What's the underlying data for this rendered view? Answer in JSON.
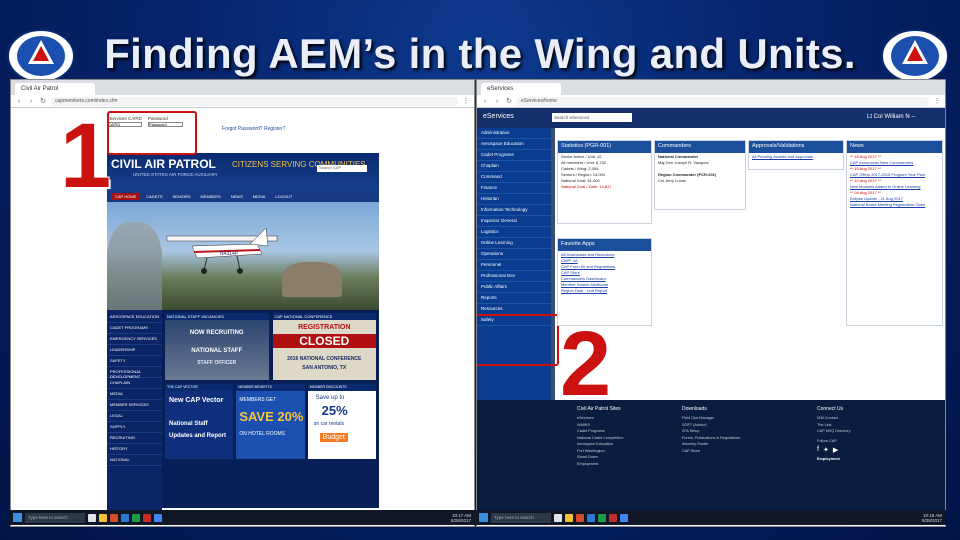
{
  "slide": {
    "title": "Finding AEM’s in the Wing and Units.",
    "step_one": "1",
    "step_two": "2",
    "colors": {
      "background": "#06236b",
      "highlight": "#cc1111",
      "title_text": "#e9eef8"
    }
  },
  "left_browser": {
    "tab_title": "Civil Air Patrol",
    "url": "capmembers.com/index.cfm",
    "login": {
      "user_label": "eServices CAPID",
      "pass_label": "Password",
      "user_value": "CAPID",
      "pass_value": "Password",
      "links": "Forgot Password?  Register?"
    },
    "site": {
      "logo": "CIVIL AIR PATROL",
      "logo_sub": "UNITED STATES AIR FORCE AUXILIARY",
      "tagline": "CITIZENS SERVING COMMUNITIES",
      "search_placeholder": "Search CAP",
      "nav": [
        "CAP HOME",
        "CADETS",
        "SENIORS",
        "MEMBERS",
        "NEWS",
        "MEDIA",
        "LOGOUT"
      ],
      "hero_plane_tail": "N4314P",
      "sidemenu": [
        "AEROSPACE EDUCATION",
        "CADET PROGRAMS",
        "EMERGENCY SERVICES",
        "LEADERSHIP",
        "SAFETY",
        "PROFESSIONAL DEVELOPMENT",
        "CHAPLAIN",
        "MEDIA",
        "MEMBER SERVICES",
        "LEGAL",
        "SUPPLY",
        "RECRUITING",
        "HISTORY",
        "NATIONAL"
      ],
      "panels": {
        "staff_vacancies": {
          "title": "NATIONAL STAFF VACANCIES",
          "line1": "NOW RECRUITING",
          "line2": "NATIONAL STAFF",
          "line3": "STAFF OFFICER"
        },
        "conference": {
          "title": "CAP NATIONAL CONFERENCE",
          "line1": "REGISTRATION",
          "line2": "CLOSED",
          "line3": "2016 NATIONAL CONFERENCE",
          "line4": "SAN ANTONIO, TX"
        },
        "cap_vector": {
          "title": "THE CAP VECTOR",
          "line1": "New CAP Vector",
          "line2": "National Staff",
          "line3": "Updates and Report"
        },
        "hotel": {
          "title": "MEMBER BENEFITS",
          "line1": "MEMBERS GET",
          "line2": "SAVE 20%",
          "line3": "ON HOTEL ROOMS"
        },
        "rental": {
          "title": "MEMBER DISCOUNTS",
          "line1": "Save up to",
          "line2": "25%",
          "line3": "on car rentals",
          "line4": "Budget"
        }
      }
    }
  },
  "right_browser": {
    "tab_title": "eServices",
    "url": "eServices/home",
    "search_value": "Search eServices",
    "user": "Lt Col William N --",
    "menu": [
      "Administration",
      "Aerospace Education",
      "Cadet Programs",
      "Chaplain",
      "Command",
      "Finance",
      "Historian",
      "Information Technology",
      "Inspector General",
      "Logistics",
      "Online Learning",
      "Operations",
      "Personnel",
      "Professional Dev",
      "Public Affairs",
      "Reports",
      "Resources",
      "Safety"
    ],
    "statistics": {
      "title": "Statistics (PGR-001)",
      "lines": [
        "Senior Active / Unit: 42",
        "All members / Unit: 6,732",
        "Cadets / Wing: 2,354",
        "Seniors / Region: 14,004",
        "National Goal: 61,000"
      ],
      "note": "National Goal / Date: 14,817"
    },
    "commanders": {
      "title": "Commanders",
      "lines": [
        "National Commander",
        "Maj Gen Joseph R. Vazquez",
        "Region Commander (PCR-001)",
        "Col Jerry Lucas"
      ]
    },
    "approvals": {
      "title": "Approvals/Validations",
      "lines": [
        "All Pending Awards and Approvals"
      ]
    },
    "news": {
      "title": "News",
      "lines": [
        "** 18 Aug 2017 **",
        "CAP Announces New Commanders",
        "** 15 Aug 2017 **",
        "CAP Offers 2017-2018 Program Year Plan",
        "** 10 Aug 2017 **",
        "New Modules Added to Online Learning",
        "** 04 Aug 2017 **",
        "Eclipse Update - 21 Aug 2017",
        "National Board Meeting Registration Open"
      ]
    },
    "favorite_apps": {
      "title": "Favorite Apps",
      "lines": [
        "All Downloads and Resources",
        "CAPF 2A",
        "CAP Form 60 and Regulations",
        "CAP Store",
        "Commanders Dashboard",
        "Member Search Additional",
        "Region Data - Unit Report"
      ]
    },
    "footer": {
      "col1_title": "Civil Air Patrol Sites",
      "col1": [
        "eServices",
        "WMIRS",
        "Cadet Programs",
        "National Cadet Competition",
        "Aerospace Education",
        "Fort Washington",
        "Stand Down",
        "Employment"
      ],
      "col2_title": "Downloads",
      "col2": [
        "Field Ops Manager",
        "SOFT (Adobe)",
        "2FA Setup",
        "Forms, Publications & Regulations",
        "Attorney Roster",
        "CAP Store"
      ],
      "col3_title": "Connect Us",
      "col3": [
        "ISM Contact",
        "The Link",
        "CAP NHQ Directory",
        "Follow CAP",
        "Employment"
      ]
    }
  },
  "taskbar": {
    "search_text": "Type here to search",
    "left_time": "10:17 AM",
    "left_date": "8/28/2017",
    "right_time": "10:18 AM",
    "right_date": "8/28/2017"
  }
}
